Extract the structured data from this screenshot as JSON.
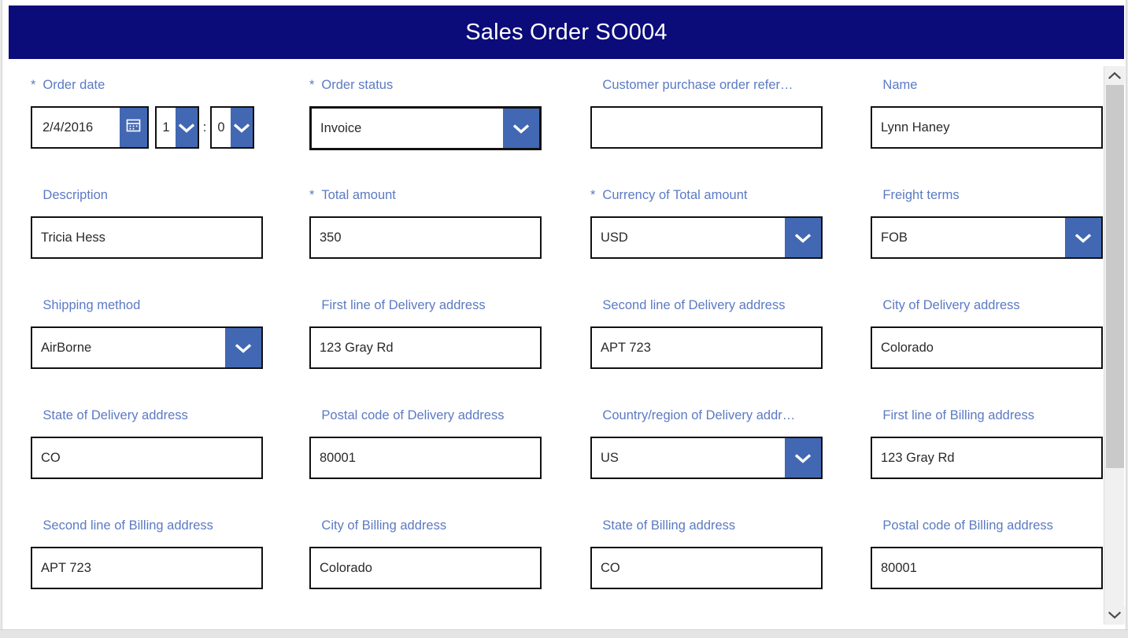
{
  "window": {
    "title": "Sales Order SO004",
    "header_color": "#0b0b7a",
    "label_color": "#5b7ac4",
    "accent_color": "#4268b3"
  },
  "form": {
    "required_marker": "*",
    "time_separator": ":",
    "fields": [
      {
        "id": "order-date",
        "label": "Order date",
        "required": true,
        "type": "datetime",
        "value": "2/4/2016",
        "hour": "1",
        "minute": "0",
        "icon": "calendar-icon"
      },
      {
        "id": "order-status",
        "label": "Order status",
        "required": true,
        "type": "combobox",
        "value": "Invoice",
        "focused": true
      },
      {
        "id": "customer-purchase-order-reference",
        "label": "Customer purchase order refer…",
        "required": false,
        "type": "textbox",
        "value": ""
      },
      {
        "id": "name",
        "label": "Name",
        "required": false,
        "type": "textbox",
        "value": "Lynn Haney"
      },
      {
        "id": "description",
        "label": "Description",
        "required": false,
        "type": "textbox",
        "value": "Tricia Hess"
      },
      {
        "id": "total-amount",
        "label": "Total amount",
        "required": true,
        "type": "textbox",
        "value": "350"
      },
      {
        "id": "currency-of-total-amount",
        "label": "Currency of Total amount",
        "required": true,
        "type": "combobox",
        "value": "USD"
      },
      {
        "id": "freight-terms",
        "label": "Freight terms",
        "required": false,
        "type": "combobox",
        "value": "FOB"
      },
      {
        "id": "shipping-method",
        "label": "Shipping method",
        "required": false,
        "type": "combobox",
        "value": "AirBorne"
      },
      {
        "id": "first-line-of-delivery-address",
        "label": "First line of Delivery address",
        "required": false,
        "type": "textbox",
        "value": "123 Gray Rd"
      },
      {
        "id": "second-line-of-delivery-address",
        "label": "Second line of Delivery address",
        "required": false,
        "type": "textbox",
        "value": "APT 723"
      },
      {
        "id": "city-of-delivery-address",
        "label": "City of Delivery address",
        "required": false,
        "type": "textbox",
        "value": "Colorado"
      },
      {
        "id": "state-of-delivery-address",
        "label": "State of Delivery address",
        "required": false,
        "type": "textbox",
        "value": "CO"
      },
      {
        "id": "postal-code-of-delivery-address",
        "label": "Postal code of Delivery address",
        "required": false,
        "type": "textbox",
        "value": "80001"
      },
      {
        "id": "country-region-of-delivery-address",
        "label": "Country/region of Delivery addr…",
        "required": false,
        "type": "combobox",
        "value": "US"
      },
      {
        "id": "first-line-of-billing-address",
        "label": "First line of Billing address",
        "required": false,
        "type": "textbox",
        "value": "123 Gray Rd"
      },
      {
        "id": "second-line-of-billing-address",
        "label": "Second line of Billing address",
        "required": false,
        "type": "textbox",
        "value": "APT 723"
      },
      {
        "id": "city-of-billing-address",
        "label": "City of Billing address",
        "required": false,
        "type": "textbox",
        "value": "Colorado"
      },
      {
        "id": "state-of-billing-address",
        "label": "State of Billing address",
        "required": false,
        "type": "textbox",
        "value": "CO"
      },
      {
        "id": "postal-code-of-billing-address",
        "label": "Postal code of Billing address",
        "required": false,
        "type": "textbox",
        "value": "80001"
      }
    ]
  },
  "scrollbar": {
    "up_icon": "chevron-up-icon",
    "down_icon": "chevron-down-icon"
  }
}
